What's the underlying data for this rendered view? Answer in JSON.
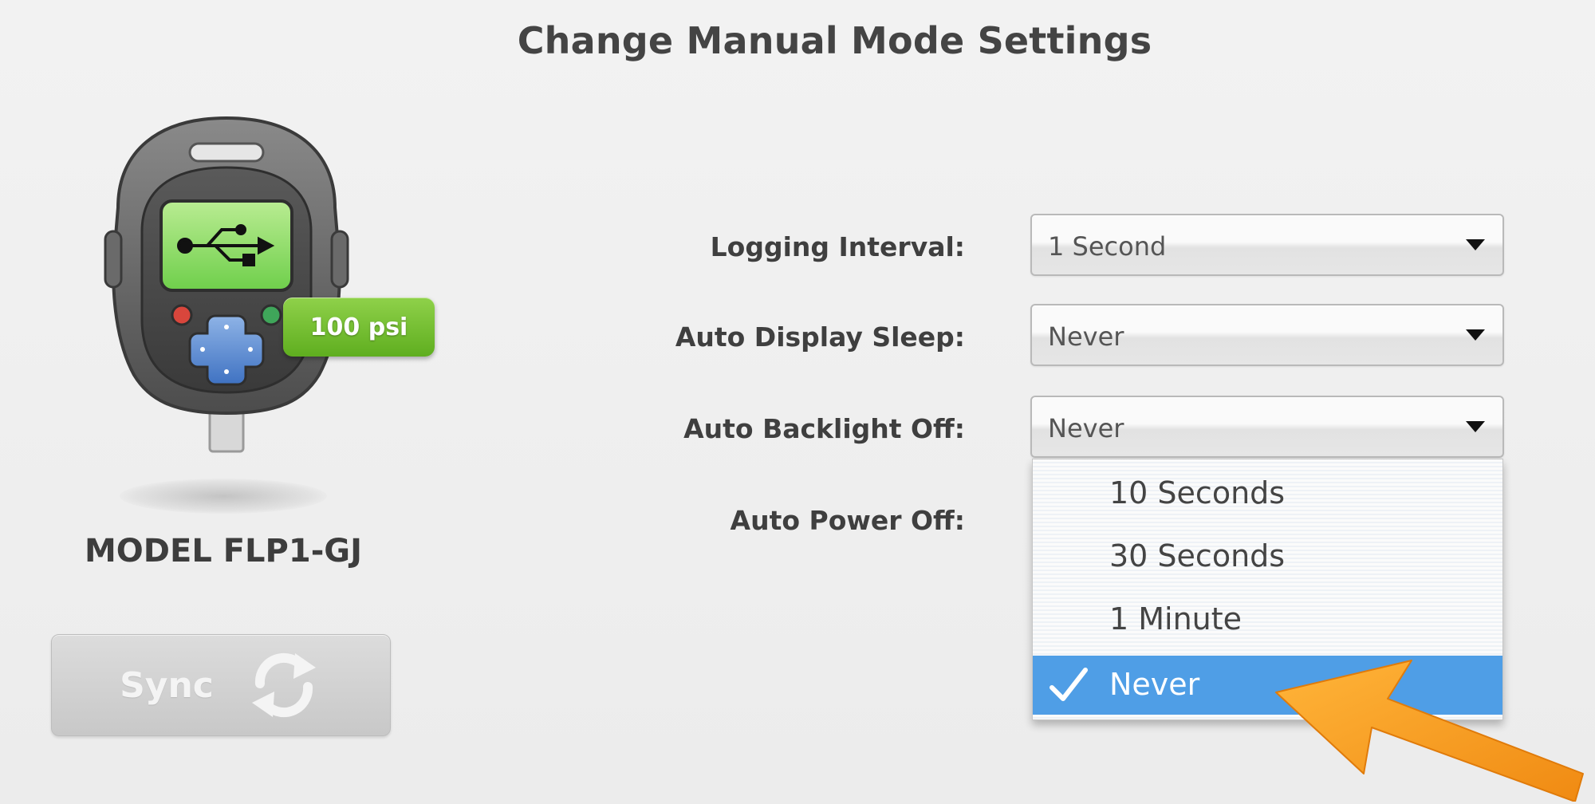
{
  "page": {
    "title": "Change Manual Mode Settings"
  },
  "device": {
    "model_name": "MODEL FLP1-GJ",
    "pressure_badge": "100 psi",
    "screen_icon": "usb-icon"
  },
  "sync": {
    "label": "Sync",
    "icon": "sync-icon"
  },
  "settings": {
    "logging_interval": {
      "label": "Logging Interval:",
      "value": "1 Second"
    },
    "auto_display_sleep": {
      "label": "Auto Display Sleep:",
      "value": "Never"
    },
    "auto_backlight_off": {
      "label": "Auto Backlight Off:",
      "value": "Never"
    },
    "auto_power_off": {
      "label": "Auto Power Off:"
    }
  },
  "dropdown": {
    "options": [
      {
        "label": "10 Seconds",
        "selected": false
      },
      {
        "label": "30 Seconds",
        "selected": false
      },
      {
        "label": "1 Minute",
        "selected": false
      },
      {
        "label": "Never",
        "selected": true
      }
    ],
    "selected_icon": "checkmark-icon"
  },
  "colors": {
    "selection_highlight": "#4f9ee6",
    "badge_green": "#6ab92a",
    "annotation_orange": "#f5a024"
  }
}
